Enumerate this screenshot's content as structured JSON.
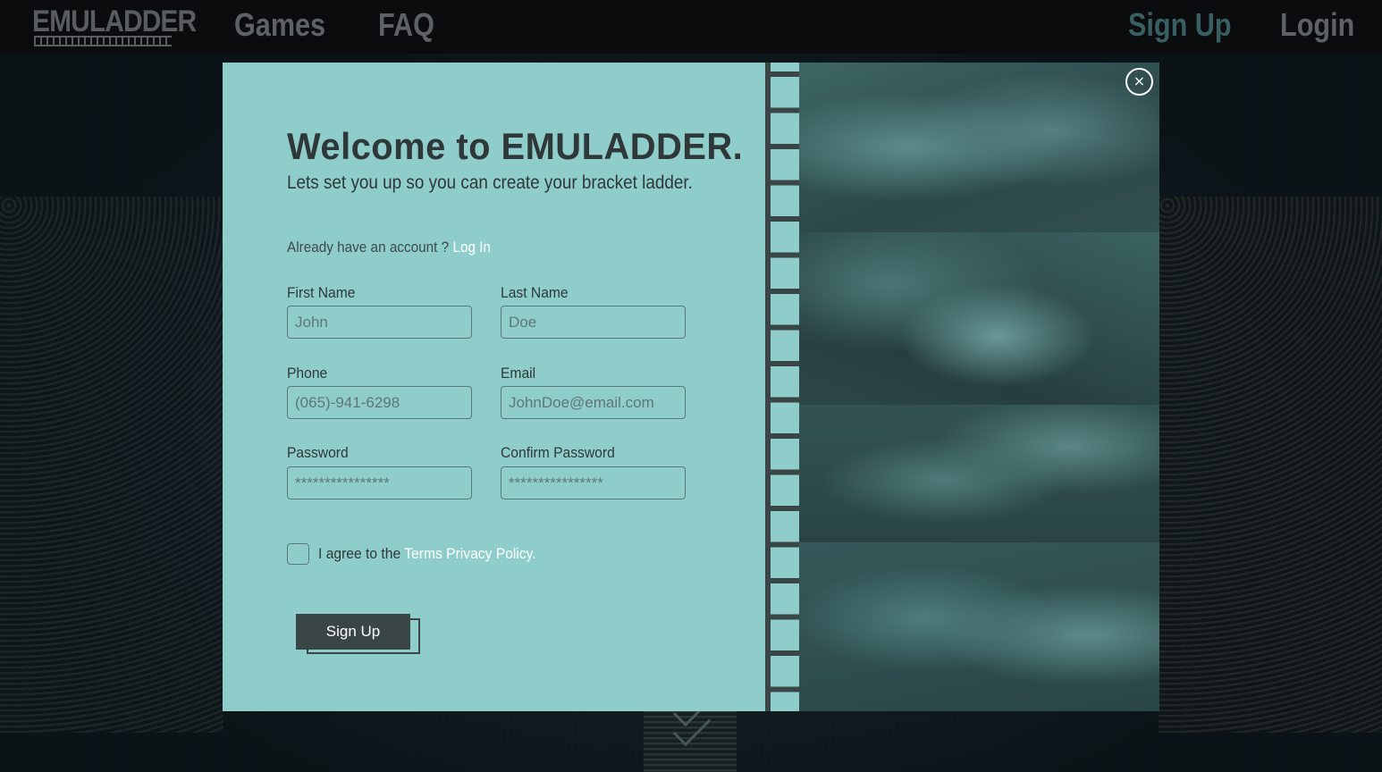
{
  "nav": {
    "logo": "EMULADDER",
    "games": "Games",
    "faq": "FAQ",
    "signup": "Sign Up",
    "login": "Login"
  },
  "modal": {
    "title": "Welcome to EMULADDER.",
    "subtitle": "Lets set you up so you can create your bracket ladder.",
    "account_prompt": "Already have an account ?",
    "login_link": "Log In",
    "fields": {
      "first_name": {
        "label": "First Name",
        "placeholder": "John"
      },
      "last_name": {
        "label": "Last Name",
        "placeholder": "Doe"
      },
      "phone": {
        "label": "Phone",
        "placeholder": "(065)-941-6298"
      },
      "email": {
        "label": "Email",
        "placeholder": "JohnDoe@email.com"
      },
      "password": {
        "label": "Password",
        "placeholder": "****************"
      },
      "confirm_password": {
        "label": "Confirm Password",
        "placeholder": "****************"
      }
    },
    "agree_prefix": "I agree to the",
    "agree_link": "Terms Privacy Policy.",
    "submit": "Sign Up",
    "close": "×"
  },
  "colors": {
    "modal_bg": "#8fcdcb",
    "dark": "#3a4546",
    "active_nav": "#385f61"
  }
}
